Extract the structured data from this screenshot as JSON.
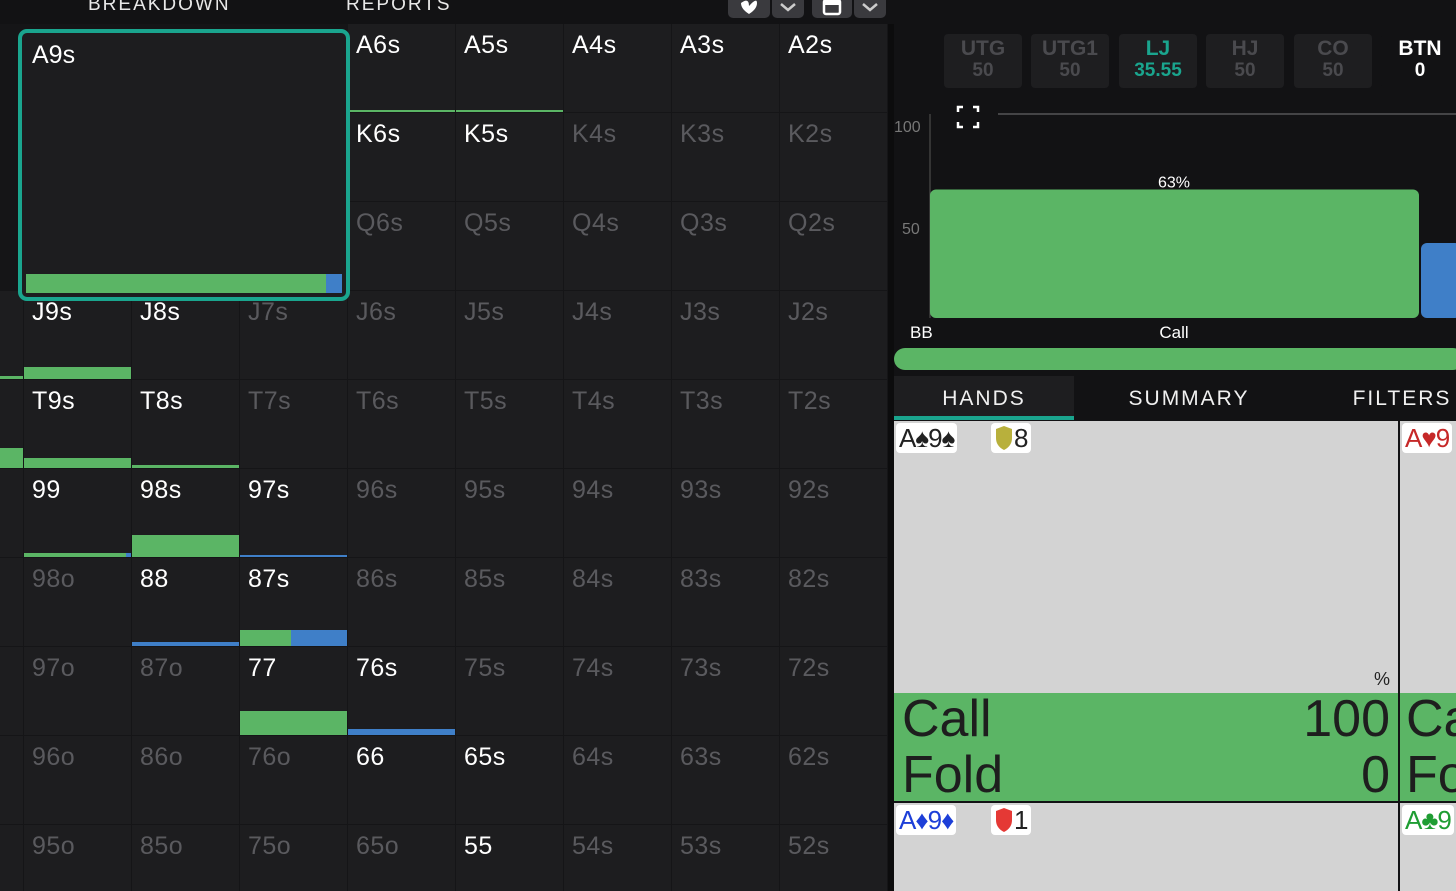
{
  "nav": {
    "breakdown": "BREAKDOWN",
    "reports": "REPORTS"
  },
  "colors": {
    "call": "#5bb565",
    "raise": "#3f7fc8",
    "accent": "#1aa58e",
    "fold_text": "#5a5a5e"
  },
  "selected_cell": {
    "label": "A9s",
    "call_pct": 95,
    "raise_pct": 5
  },
  "grid_rows": [
    [
      {
        "t": "A6s",
        "a": true
      },
      {
        "t": "A5s",
        "a": true
      },
      {
        "t": "A4s",
        "a": true
      },
      {
        "t": "A3s",
        "a": true
      },
      {
        "t": "A2s",
        "a": true
      }
    ],
    [
      {
        "t": "K6s",
        "a": true
      },
      {
        "t": "K5s",
        "a": true
      },
      {
        "t": "K4s",
        "a": false
      },
      {
        "t": "K3s",
        "a": false
      },
      {
        "t": "K2s",
        "a": false
      }
    ],
    [
      {
        "t": "Q6s",
        "a": false
      },
      {
        "t": "Q5s",
        "a": false
      },
      {
        "t": "Q4s",
        "a": false
      },
      {
        "t": "Q3s",
        "a": false
      },
      {
        "t": "Q2s",
        "a": false
      }
    ],
    [
      {
        "t": "J9s",
        "a": true
      },
      {
        "t": "J8s",
        "a": true
      },
      {
        "t": "J7s",
        "a": false
      },
      {
        "t": "J6s",
        "a": false
      },
      {
        "t": "J5s",
        "a": false
      },
      {
        "t": "J4s",
        "a": false
      },
      {
        "t": "J3s",
        "a": false
      },
      {
        "t": "J2s",
        "a": false
      }
    ],
    [
      {
        "t": "T9s",
        "a": true
      },
      {
        "t": "T8s",
        "a": true
      },
      {
        "t": "T7s",
        "a": false
      },
      {
        "t": "T6s",
        "a": false
      },
      {
        "t": "T5s",
        "a": false
      },
      {
        "t": "T4s",
        "a": false
      },
      {
        "t": "T3s",
        "a": false
      },
      {
        "t": "T2s",
        "a": false
      }
    ],
    [
      {
        "t": "99",
        "a": true
      },
      {
        "t": "98s",
        "a": true
      },
      {
        "t": "97s",
        "a": true
      },
      {
        "t": "96s",
        "a": false
      },
      {
        "t": "95s",
        "a": false
      },
      {
        "t": "94s",
        "a": false
      },
      {
        "t": "93s",
        "a": false
      },
      {
        "t": "92s",
        "a": false
      }
    ],
    [
      {
        "t": "98o",
        "a": false
      },
      {
        "t": "88",
        "a": true
      },
      {
        "t": "87s",
        "a": true
      },
      {
        "t": "86s",
        "a": false
      },
      {
        "t": "85s",
        "a": false
      },
      {
        "t": "84s",
        "a": false
      },
      {
        "t": "83s",
        "a": false
      },
      {
        "t": "82s",
        "a": false
      }
    ],
    [
      {
        "t": "97o",
        "a": false
      },
      {
        "t": "87o",
        "a": false
      },
      {
        "t": "77",
        "a": true
      },
      {
        "t": "76s",
        "a": true
      },
      {
        "t": "75s",
        "a": false
      },
      {
        "t": "74s",
        "a": false
      },
      {
        "t": "73s",
        "a": false
      },
      {
        "t": "72s",
        "a": false
      }
    ],
    [
      {
        "t": "96o",
        "a": false
      },
      {
        "t": "86o",
        "a": false
      },
      {
        "t": "76o",
        "a": false
      },
      {
        "t": "66",
        "a": true
      },
      {
        "t": "65s",
        "a": true
      },
      {
        "t": "64s",
        "a": false
      },
      {
        "t": "63s",
        "a": false
      },
      {
        "t": "62s",
        "a": false
      }
    ],
    [
      {
        "t": "95o",
        "a": false
      },
      {
        "t": "85o",
        "a": false
      },
      {
        "t": "75o",
        "a": false
      },
      {
        "t": "65o",
        "a": false
      },
      {
        "t": "55",
        "a": true
      },
      {
        "t": "54s",
        "a": false
      },
      {
        "t": "53s",
        "a": false
      },
      {
        "t": "52s",
        "a": false
      }
    ]
  ],
  "positions": [
    {
      "name": "UTG",
      "stack": "50",
      "active": false
    },
    {
      "name": "UTG1",
      "stack": "50",
      "active": false
    },
    {
      "name": "LJ",
      "stack": "35.55",
      "active": true
    },
    {
      "name": "HJ",
      "stack": "50",
      "active": false
    },
    {
      "name": "CO",
      "stack": "50",
      "active": false
    },
    {
      "name": "BTN",
      "stack": "0",
      "active": true
    }
  ],
  "chart_data": {
    "type": "bar",
    "ylabel_ticks": [
      "100",
      "50"
    ],
    "bars": [
      {
        "label": "Call",
        "value": 63,
        "value_label": "63%"
      }
    ],
    "xlabel_left": "BB"
  },
  "tabs": {
    "hands": "HANDS",
    "summary": "SUMMARY",
    "filters": "FILTERS"
  },
  "hand_cards": [
    {
      "combo": "A♠9♠",
      "weight": "8",
      "percent": "%",
      "actions": [
        {
          "name": "Call",
          "value": "100"
        },
        {
          "name": "Fold",
          "value": "0"
        }
      ]
    },
    {
      "combo": "A♦9♦",
      "weight": "1"
    },
    {
      "combo": "A♥9",
      "partial_actions": [
        "Ca",
        "Fo"
      ]
    },
    {
      "combo": "A♣9"
    }
  ]
}
